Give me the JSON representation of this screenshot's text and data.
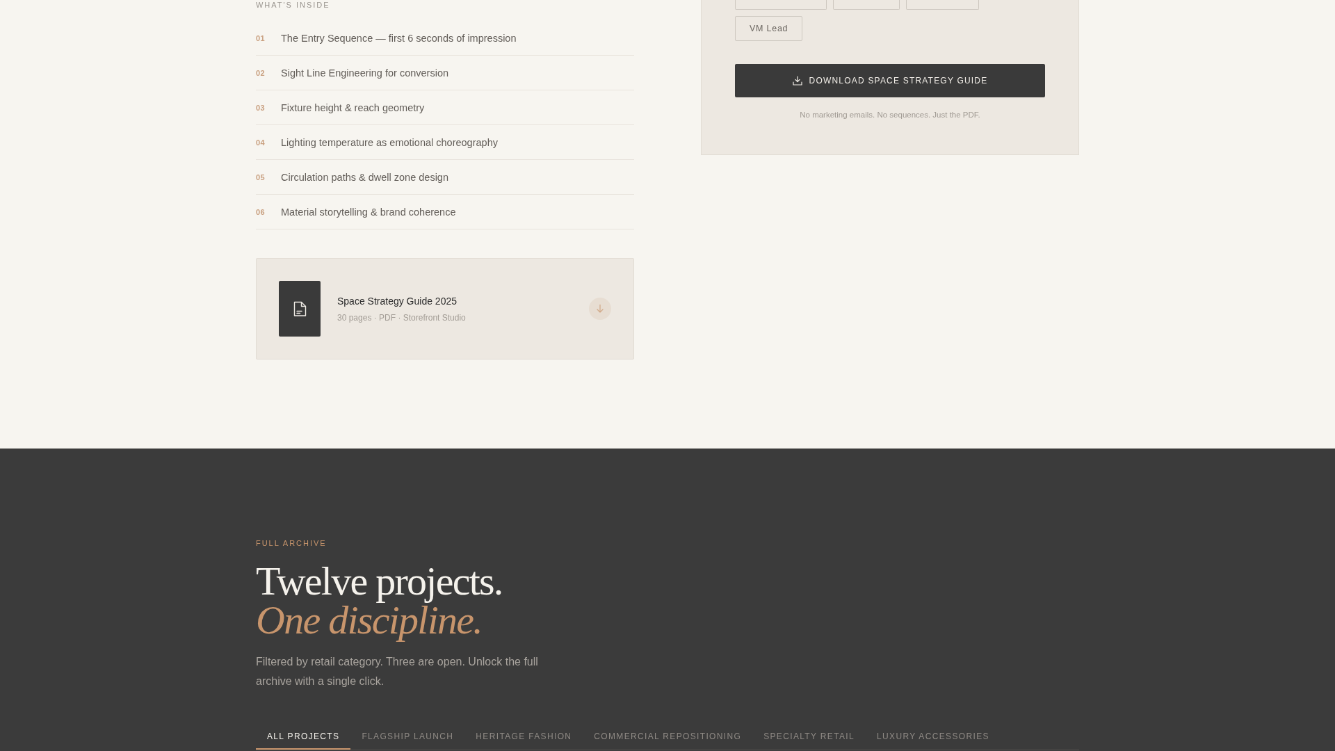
{
  "contents": {
    "label": "WHAT'S INSIDE",
    "items": [
      {
        "number": "01",
        "title": "The Entry Sequence — first 6 seconds of impression"
      },
      {
        "number": "02",
        "title": "Sight Line Engineering for conversion"
      },
      {
        "number": "03",
        "title": "Fixture height & reach geometry"
      },
      {
        "number": "04",
        "title": "Lighting temperature as emotional choreography"
      },
      {
        "number": "05",
        "title": "Circulation paths & dwell zone design"
      },
      {
        "number": "06",
        "title": "Material storytelling & brand coherence"
      }
    ]
  },
  "file_card": {
    "title": "Space Strategy Guide 2025",
    "meta": "30 pages · PDF · Storefront Studio"
  },
  "request_form": {
    "option_chips": [
      {
        "kind": "clipped",
        "selected": false
      },
      {
        "kind": "clipped",
        "selected": false
      },
      {
        "kind": "clipped",
        "selected": false
      },
      {
        "kind": "full",
        "label": "VM Lead",
        "selected": false
      }
    ],
    "submit_button": "DOWNLOAD SPACE STRATEGY GUIDE",
    "note": "No marketing emails. No sequences. Just the PDF."
  },
  "archive": {
    "eyebrow": "FULL ARCHIVE",
    "heading": "Twelve projects.",
    "heading_accent": "One discipline.",
    "description": "Filtered by retail category. Three are open. Unlock the full archive with a single click.",
    "tabs": [
      {
        "label": "ALL PROJECTS",
        "selected": true
      },
      {
        "label": "FLAGSHIP LAUNCH",
        "selected": false
      },
      {
        "label": "HERITAGE FASHION",
        "selected": false
      },
      {
        "label": "COMMERCIAL REPOSITIONING",
        "selected": false
      },
      {
        "label": "SPECIALTY RETAIL",
        "selected": false
      },
      {
        "label": "LUXURY ACCESSORIES",
        "selected": false
      }
    ]
  }
}
